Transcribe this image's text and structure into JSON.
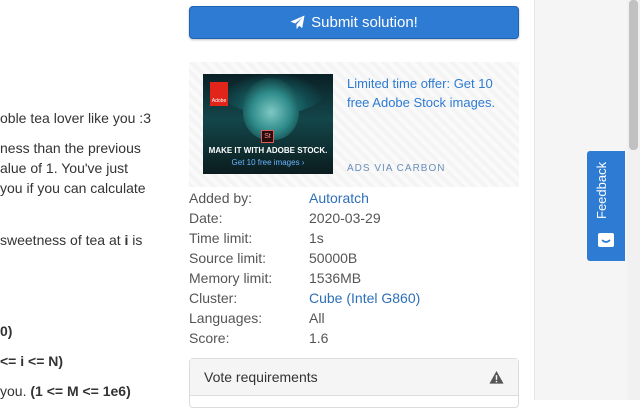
{
  "problem_text": {
    "line1": "oble tea lover like you :3",
    "line2": "ness than the previous",
    "line3": "alue of 1. You've just",
    "line4": "you if you can calculate",
    "line5_pre": "sweetness of tea at ",
    "line5_bold": "i",
    "line5_post": " is",
    "line6": "0)",
    "line7": "<= i  <= N)",
    "line8_pre": " you. ",
    "line8_bold": "(1 <= M <= 1e6)"
  },
  "submit": {
    "label": "Submit solution!",
    "icon": "paper-plane-icon"
  },
  "ad": {
    "brand": "Adobe",
    "badge": "St",
    "image_line1": "MAKE IT WITH ADOBE STOCK.",
    "image_line2": "Get 10 free images ›",
    "text": "Limited time offer: Get 10 free Adobe Stock images.",
    "via": "ADS VIA CARBON"
  },
  "info": {
    "added_by_label": "Added by:",
    "added_by_value": "Autoratch",
    "date_label": "Date:",
    "date_value": "2020-03-29",
    "time_limit_label": "Time limit:",
    "time_limit_value": "1s",
    "source_limit_label": "Source limit:",
    "source_limit_value": "50000B",
    "memory_limit_label": "Memory limit:",
    "memory_limit_value": "1536MB",
    "cluster_label": "Cluster:",
    "cluster_value": "Cube (Intel G860)",
    "languages_label": "Languages:",
    "languages_value": "All",
    "score_label": "Score:",
    "score_value": "1.6"
  },
  "vote": {
    "title": "Vote requirements",
    "icon": "warning-icon"
  },
  "feedback": {
    "label": "Feedback",
    "icon": "chat-face-icon"
  },
  "colors": {
    "primary": "#2e7bd3",
    "link": "#2e6fb8"
  }
}
